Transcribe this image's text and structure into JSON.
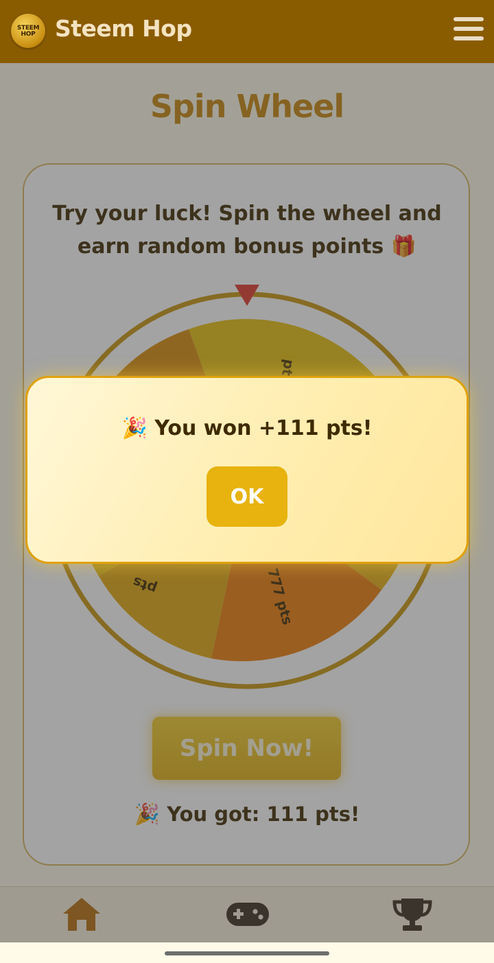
{
  "header": {
    "app_title": "Steem Hop",
    "logo_text": "STEEM HOP",
    "menu_icon": "hamburger-menu-icon"
  },
  "page": {
    "title": "Spin Wheel",
    "intro_line1": "Try your luck! Spin the wheel and",
    "intro_line2": "earn random bonus points 🎁",
    "spin_button_label": "Spin Now!",
    "result_emoji": "🎉",
    "result_text": "You got: 111 pts!"
  },
  "wheel": {
    "segment_labels": [
      "pts",
      "777 pts",
      "pts"
    ],
    "segment_colors": [
      "#e7bf0f",
      "#d98d0a",
      "#e2a80f",
      "#ee7d0a"
    ],
    "pointer_color": "#e03a2c",
    "rim_color": "#c8960e"
  },
  "modal": {
    "emoji": "🎉",
    "message": "You won +111 pts!",
    "ok_label": "OK"
  },
  "bottom_nav": {
    "items": [
      {
        "icon": "home-icon",
        "active": true
      },
      {
        "icon": "gamepad-icon",
        "active": false
      },
      {
        "icon": "trophy-icon",
        "active": false
      }
    ]
  },
  "colors": {
    "header_bg": "#8a5c00",
    "accent": "#e8b30f",
    "title": "#c8860c",
    "text_dark": "#3f2a00"
  }
}
